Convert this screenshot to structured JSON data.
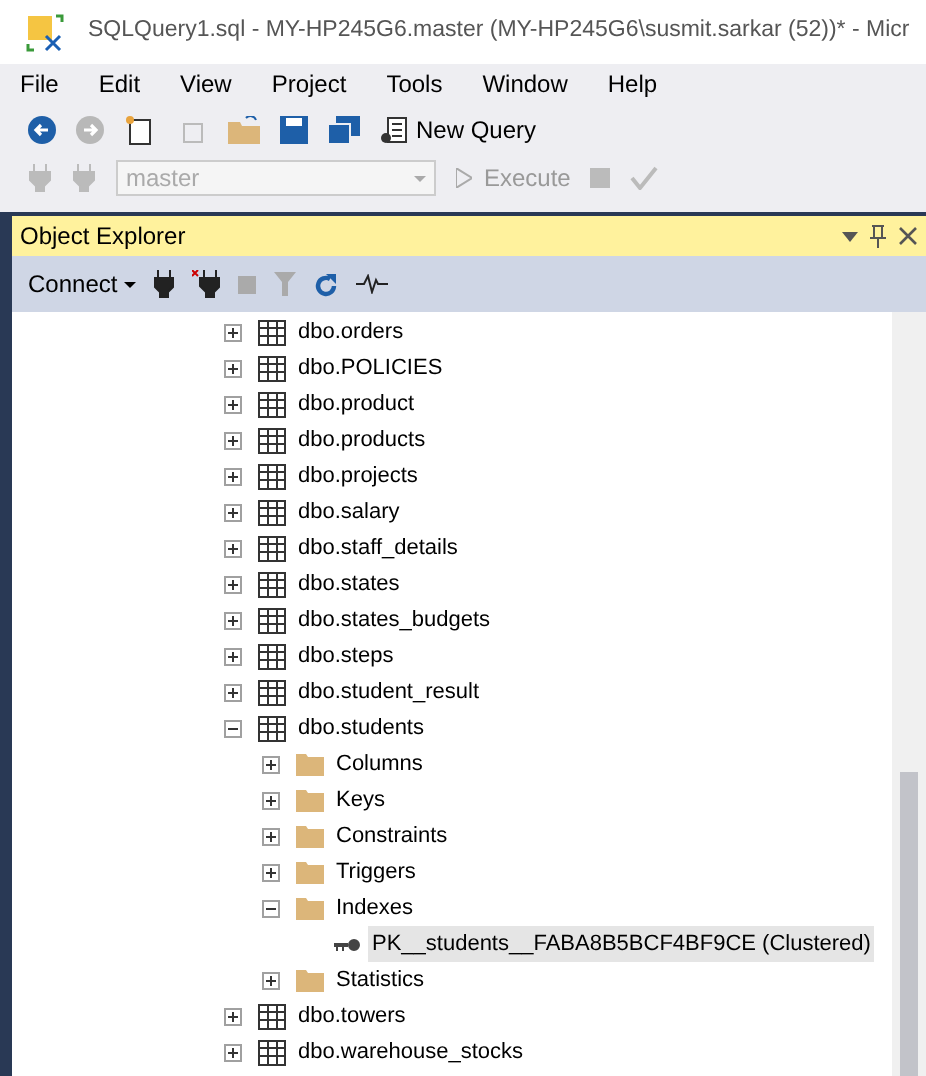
{
  "window": {
    "title": "SQLQuery1.sql - MY-HP245G6.master (MY-HP245G6\\susmit.sarkar (52))* - Micr"
  },
  "menu": [
    "File",
    "Edit",
    "View",
    "Project",
    "Tools",
    "Window",
    "Help"
  ],
  "toolbar": {
    "new_query": "New Query",
    "database": "master",
    "execute": "Execute"
  },
  "object_explorer": {
    "title": "Object Explorer",
    "connect": "Connect",
    "tree": [
      {
        "label": "dbo.orders",
        "kind": "table",
        "expanded": false,
        "selected": false
      },
      {
        "label": "dbo.POLICIES",
        "kind": "table",
        "expanded": false,
        "selected": false
      },
      {
        "label": "dbo.product",
        "kind": "table",
        "expanded": false,
        "selected": false
      },
      {
        "label": "dbo.products",
        "kind": "table",
        "expanded": false,
        "selected": false
      },
      {
        "label": "dbo.projects",
        "kind": "table",
        "expanded": false,
        "selected": false
      },
      {
        "label": "dbo.salary",
        "kind": "table",
        "expanded": false,
        "selected": false
      },
      {
        "label": "dbo.staff_details",
        "kind": "table",
        "expanded": false,
        "selected": false
      },
      {
        "label": "dbo.states",
        "kind": "table",
        "expanded": false,
        "selected": false
      },
      {
        "label": "dbo.states_budgets",
        "kind": "table",
        "expanded": false,
        "selected": false
      },
      {
        "label": "dbo.steps",
        "kind": "table",
        "expanded": false,
        "selected": false
      },
      {
        "label": "dbo.student_result",
        "kind": "table",
        "expanded": false,
        "selected": false
      },
      {
        "label": "dbo.students",
        "kind": "table",
        "expanded": true,
        "selected": false,
        "children": [
          {
            "label": "Columns",
            "kind": "folder",
            "expanded": false,
            "selected": false
          },
          {
            "label": "Keys",
            "kind": "folder",
            "expanded": false,
            "selected": false
          },
          {
            "label": "Constraints",
            "kind": "folder",
            "expanded": false,
            "selected": false
          },
          {
            "label": "Triggers",
            "kind": "folder",
            "expanded": false,
            "selected": false
          },
          {
            "label": "Indexes",
            "kind": "folder",
            "expanded": true,
            "selected": false,
            "children": [
              {
                "label": "PK__students__FABA8B5BCF4BF9CE (Clustered)",
                "kind": "index",
                "selected": true
              }
            ]
          },
          {
            "label": "Statistics",
            "kind": "folder",
            "expanded": false,
            "selected": false
          }
        ]
      },
      {
        "label": "dbo.towers",
        "kind": "table",
        "expanded": false,
        "selected": false
      },
      {
        "label": "dbo.warehouse_stocks",
        "kind": "table",
        "expanded": false,
        "selected": false
      }
    ]
  }
}
